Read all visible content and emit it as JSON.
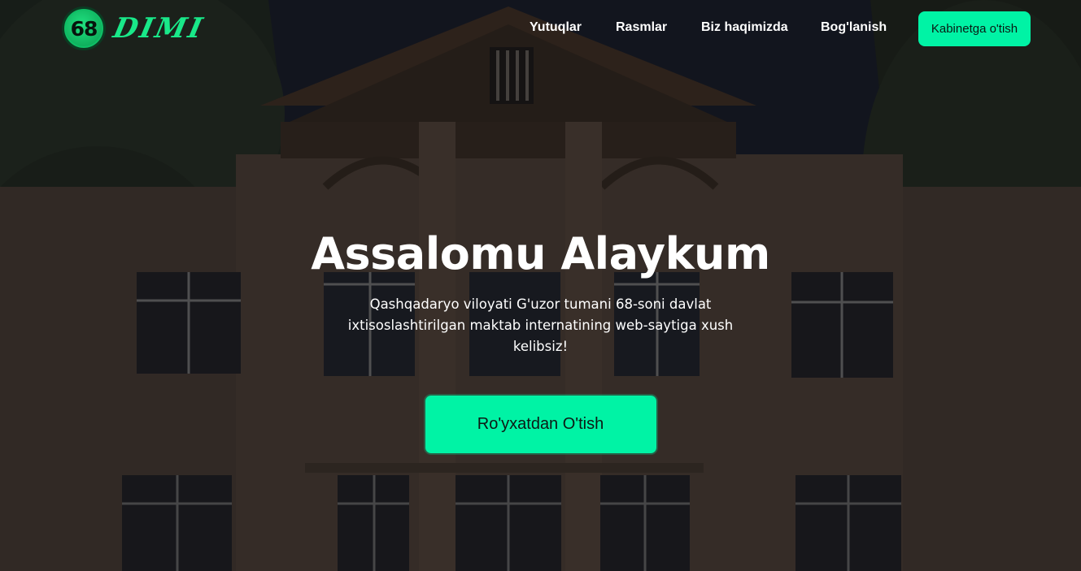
{
  "logo": {
    "badge_number": "68",
    "text": "DIMI"
  },
  "nav": {
    "items": [
      {
        "label": "Yutuqlar"
      },
      {
        "label": "Rasmlar"
      },
      {
        "label": "Biz haqimizda"
      },
      {
        "label": "Bog'lanish"
      }
    ],
    "cabinet_button": "Kabinetga o'tish"
  },
  "hero": {
    "title": "Assalomu Alaykum",
    "subtitle": "Qashqadaryo viloyati G'uzor tumani 68-soni davlat ixtisoslashtirilgan maktab internatining web-saytiga xush kelibsiz!",
    "register_button": "Ro'yxatdan O'tish"
  },
  "colors": {
    "accent": "#00f3a5",
    "logo_green": "#19e889",
    "text": "#ffffff"
  }
}
